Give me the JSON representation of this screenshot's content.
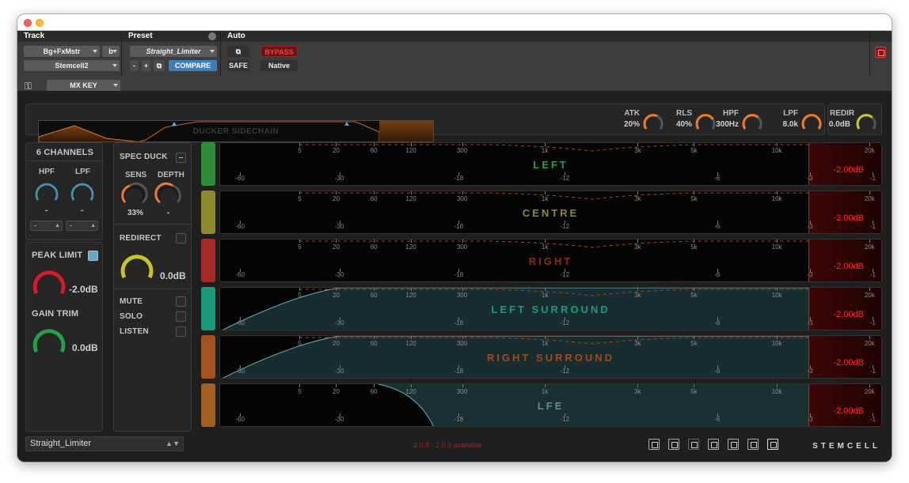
{
  "header": {
    "track_title": "Track",
    "preset_title": "Preset",
    "auto_title": "Auto",
    "track_name": "Bg+FxMstr",
    "track_channel": "b",
    "insert_name": "Stemcell2",
    "preset_name": "Straight_Limiter",
    "minus_label": "-",
    "plus_label": "+",
    "compare_label": "COMPARE",
    "safe_label": "SAFE",
    "bypass_label": "BYPASS",
    "native_label": "Native",
    "key_input": "MX KEY"
  },
  "top": {
    "sidechain_label": "DUCKER SIDECHAIN",
    "knobs": [
      {
        "label": "ATK",
        "value": "20%",
        "color": "#f07c23",
        "fill": 0.45
      },
      {
        "label": "RLS",
        "value": "40%",
        "color": "#f07c23",
        "fill": 0.55
      },
      {
        "label": "HPF",
        "value": "300Hz",
        "color": "#f07c23",
        "fill": 0.5
      },
      {
        "label": "LPF",
        "value": "8.0k",
        "color": "#f07c23",
        "fill": 0.85
      }
    ],
    "redir": {
      "label": "REDIR",
      "value": "0.0dB",
      "color": "#cfc52a",
      "fill": 0.5
    }
  },
  "channels_panel": {
    "title": "6 CHANNELS",
    "hpf_label": "HPF",
    "lpf_label": "LPF",
    "hpf_value": "-",
    "lpf_value": "-",
    "hpf_select": "-",
    "lpf_select": "-",
    "peak_limit_label": "PEAK LIMIT",
    "peak_limit_value": "-2.0dB",
    "gain_trim_label": "GAIN TRIM",
    "gain_trim_value": "0.0dB"
  },
  "spec_panel": {
    "spec_duck_label": "SPEC DUCK",
    "sens_label": "SENS",
    "depth_label": "DEPTH",
    "sens_value": "33%",
    "depth_value": "-",
    "redirect_label": "REDIRECT",
    "redirect_value": "0.0dB",
    "mute_label": "MUTE",
    "solo_label": "SOLO",
    "listen_label": "LISTEN"
  },
  "freq_ticks": [
    "5",
    "20",
    "60",
    "120",
    "300",
    "1k",
    "3k",
    "5k",
    "10k",
    "20k"
  ],
  "db_ticks": [
    "-60",
    "-30",
    "-18",
    "-12",
    "-6",
    "-3",
    "-1"
  ],
  "meters": [
    {
      "name": "LEFT",
      "color": "#1f9c59",
      "strip": "#2e8b3a",
      "limit": "-2.00dB",
      "filter": "none"
    },
    {
      "name": "CENTRE",
      "color": "#8f8a2a",
      "strip": "#8e8a2b",
      "limit": "-2.00dB",
      "filter": "none"
    },
    {
      "name": "RIGHT",
      "color": "#8f2626",
      "strip": "#a62a2a",
      "limit": "-2.00dB",
      "filter": "none"
    },
    {
      "name": "LEFT SURROUND",
      "color": "#1b9a7c",
      "strip": "#1b9a7a",
      "limit": "-2.00dB",
      "filter": "hpf"
    },
    {
      "name": "RIGHT SURROUND",
      "color": "#9a4d22",
      "strip": "#a3521f",
      "limit": "-2.00dB",
      "filter": "hpf"
    },
    {
      "name": "LFE",
      "color": "#5a8f94",
      "strip": "#a35f20",
      "limit": "-2.00dB",
      "filter": "lpf"
    }
  ],
  "footer": {
    "preset_select": "Straight_Limiter",
    "update_text": "2.0.8 - 2.0.9 available",
    "brand": "STEMCELL"
  }
}
